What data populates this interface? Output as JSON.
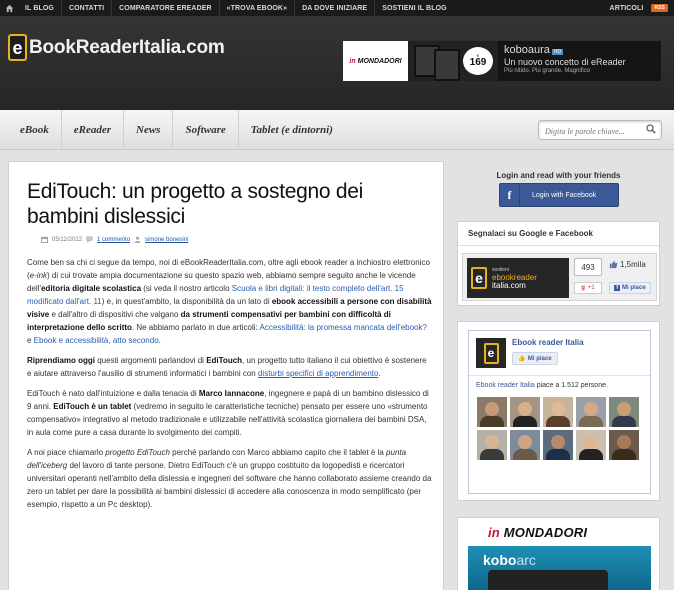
{
  "topbar": {
    "home_icon": "home-icon",
    "nav": [
      "IL BLOG",
      "CONTATTI",
      "COMPARATORE EREADER",
      "«TROVA EBOOK»",
      "DA DOVE INIZIARE",
      "SOSTIENI IL BLOG"
    ],
    "right_link": "ARTICOLI",
    "rss": "RSS"
  },
  "header": {
    "logo_letter": "e",
    "logo_text": "BookReaderItalia.com",
    "banner": {
      "brand_mark": "in",
      "brand": "MONDADORI",
      "price": "169",
      "price_currency": "€",
      "product": "kobo",
      "product_variant": "aura",
      "badge": "HD",
      "line1": "Un nuovo concetto di eReader",
      "line2": "Più nitido. Più grande. Magnifico"
    }
  },
  "menu": {
    "items": [
      "eBook",
      "eReader",
      "News",
      "Software",
      "Tablet (e dintorni)"
    ],
    "search_placeholder": "Digita le parole chiave..."
  },
  "article": {
    "title": "EdiTouch: un progetto a sostegno dei bambini dislessici",
    "date": "05/12/2012",
    "comments": "1 commento",
    "author": "simone bonesini",
    "p1": {
      "t1": "Come ben sa chi ci segue da tempo, noi di eBookReaderItalia.com, oltre agli ebook reader a inchiostro elettronico (",
      "t2": "e-ink",
      "t3": ") di cui trovate ampia documentazione su questo spazio web, abbiamo sempre seguito anche le vicende dell'",
      "t4": "editoria digitale scolastica",
      "t5": " (si veda il nostro articolo ",
      "l1": "Scuola e libri digitali: il testo completo dell'art. 15 modificato dall'art. 11",
      "t6": ") e, in quest'ambito, la disponibilità da un lato di ",
      "t7": "ebook accessibili a persone con disabilità visive",
      "t8": " e dall'altro di dispositivi che valgano ",
      "t9": "da strumenti compensativi per bambini con difficoltà di interpretazione dello scritto",
      "t10": ". Ne abbiamo parlato in due articoli: ",
      "l2": "Accessibilità: la promessa mancata dell'ebook?",
      "t11": " e ",
      "l3": "Ebook e accessibilità, atto secondo",
      "t12": "."
    },
    "p2": {
      "t1": "Riprendiamo oggi",
      "t2": " questi argomenti parlandovi di ",
      "t3": "EdiTouch",
      "t4": ", un progetto tutto italiano il cui obiettivo è sostenere e aiutare attraverso l'ausilio di strumenti informatici i bambini con ",
      "l1": "disturbi specifici di apprendimento",
      "t5": "."
    },
    "p3": {
      "t1": "EdiTouch è nato dall'intuizione e dalla tenacia di ",
      "t2": "Marco Iannacone",
      "t3": ", ingegnere e papà di un bambino dislessico di 9 anni. ",
      "t4": "EdiTouch è un tablet",
      "t5": " (vedremo in seguito le caratteristiche tecniche) pensato per essere uno «strumento compensativo» integrativo al metodo tradizionale e utilizzabile nell'attività scolastica giornaliera dei bambini DSA, in aula come pure a casa durante lo svolgimento dei compiti."
    },
    "p4": {
      "t1": "A noi piace chiamarlo ",
      "t2": "progetto EdiTouch",
      "t3": " perché parlando con Marco abbiamo capito che il tablet è la ",
      "t4": "punta dell'iceberg",
      "t5": " del lavoro di tante persone. Dietro EdiTouch c'è un gruppo costituito da logopedisti e ricercatori universitari operanti nell'ambito della dislessia e ingegneri del software che hanno collaborato assieme creando da zero un tablet per dare la possibilità ai bambini dislessici di accedere alla conoscenza in modo semplificato (per esempio, rispetto a un Pc desktop)."
    }
  },
  "sidebar": {
    "login_title": "Login and read with your friends",
    "login_button": "Login with Facebook",
    "signal_title": "Segnalaci su Google e Facebook",
    "widget": {
      "small": "sostieni",
      "line1": "ebookreader",
      "line2": "italia.com",
      "count": "493",
      "like_count": "1,5mila",
      "gplus": "+1",
      "mipiace": "Mi piace"
    },
    "fb": {
      "page_name": "Ebook reader Italia",
      "mipiace": "Mi piace",
      "count_name": "Ebook reader Italia",
      "count_text": " piace a 1.512 persone.",
      "faces": [
        {
          "name": "",
          "skin": "#c99a77",
          "shirt": "#4a3a2a",
          "bg": "#8a7a6a"
        },
        {
          "name": "",
          "skin": "#d7b08a",
          "shirt": "#222222",
          "bg": "#a49484"
        },
        {
          "name": "",
          "skin": "#e0b894",
          "shirt": "#5a3d2a",
          "bg": "#c7b49c"
        },
        {
          "name": "",
          "skin": "#d3ab88",
          "shirt": "#7a6a55",
          "bg": "#9aa0a8"
        },
        {
          "name": "",
          "skin": "#c89c78",
          "shirt": "#2f3a4a",
          "bg": "#7d8a7a"
        },
        {
          "name": "",
          "skin": "#d9b591",
          "shirt": "#3a3a3a",
          "bg": "#b4b0a8"
        },
        {
          "name": "",
          "skin": "#cfa581",
          "shirt": "#6a5a4a",
          "bg": "#7c8c9c"
        },
        {
          "name": "",
          "skin": "#b98a6a",
          "shirt": "#1e2f4a",
          "bg": "#5c6c7c"
        },
        {
          "name": "",
          "skin": "#dcb892",
          "shirt": "#222222",
          "bg": "#cbc0b0"
        },
        {
          "name": "",
          "skin": "#a87a5a",
          "shirt": "#3a2a1a",
          "bg": "#6a5a4a"
        }
      ]
    },
    "ad": {
      "brand_mark": "in",
      "brand": "MONDADORI",
      "product": "kobo",
      "variant": "arc"
    }
  }
}
